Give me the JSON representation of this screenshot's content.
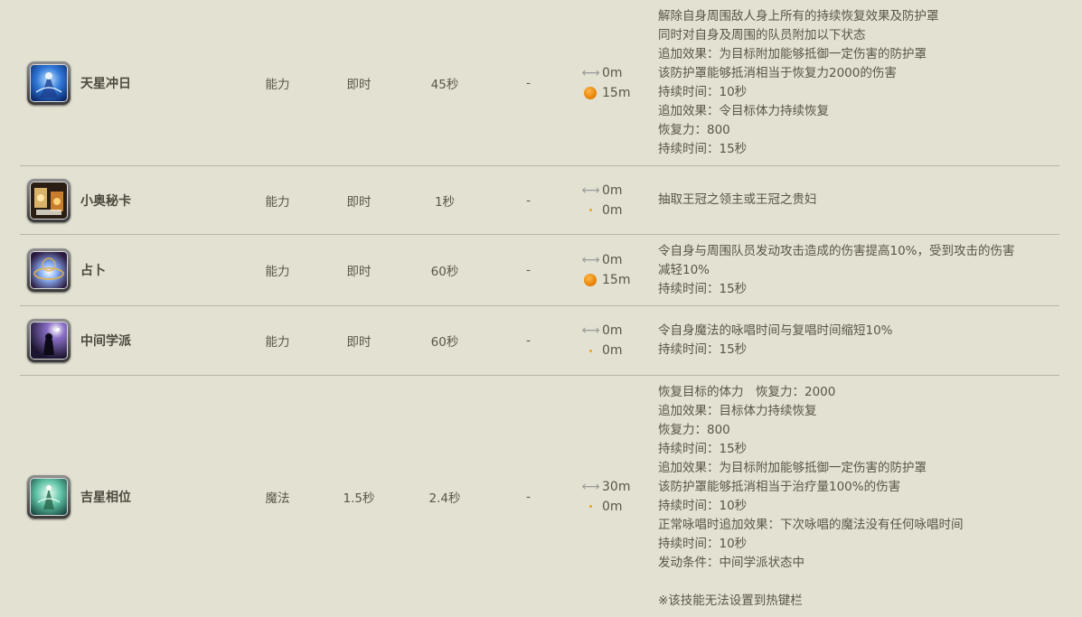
{
  "rows": [
    {
      "name": "天星冲日",
      "type": "能力",
      "cast": "即时",
      "recast": "45秒",
      "cost": "-",
      "range": "0m",
      "radius": "15m",
      "radius_marker": "orb",
      "icon": "astrologian-celestial-opposition-icon",
      "desc": [
        "解除自身周围敌人身上所有的持续恢复效果及防护罩",
        "同时对自身及周围的队员附加以下状态",
        "追加效果：为目标附加能够抵御一定伤害的防护罩",
        "该防护罩能够抵消相当于恢复力2000的伤害",
        "持续时间：10秒",
        "追加效果：令目标体力持续恢复",
        "恢复力：800",
        "持续时间：15秒"
      ]
    },
    {
      "name": "小奥秘卡",
      "type": "能力",
      "cast": "即时",
      "recast": "1秒",
      "cost": "-",
      "range": "0m",
      "radius": "0m",
      "radius_marker": "dot",
      "icon": "minor-arcana-icon",
      "desc": [
        "抽取王冠之领主或王冠之贵妇"
      ]
    },
    {
      "name": "占卜",
      "type": "能力",
      "cast": "即时",
      "recast": "60秒",
      "cost": "-",
      "range": "0m",
      "radius": "15m",
      "radius_marker": "orb",
      "icon": "divination-icon",
      "desc": [
        "令自身与周围队员发动攻击造成的伤害提高10%，受到攻击的伤害",
        "减轻10%",
        "持续时间：15秒"
      ]
    },
    {
      "name": "中间学派",
      "type": "能力",
      "cast": "即时",
      "recast": "60秒",
      "cost": "-",
      "range": "0m",
      "radius": "0m",
      "radius_marker": "dot",
      "icon": "neutral-sect-icon",
      "desc": [
        "令自身魔法的咏唱时间与复唱时间缩短10%",
        "持续时间：15秒"
      ]
    },
    {
      "name": "吉星相位",
      "type": "魔法",
      "cast": "1.5秒",
      "recast": "2.4秒",
      "cost": "-",
      "range": "30m",
      "radius": "0m",
      "radius_marker": "dot",
      "icon": "aspected-benefic-icon",
      "desc": [
        "恢复目标的体力　恢复力：2000",
        "追加效果：目标体力持续恢复",
        "恢复力：800",
        "持续时间：15秒",
        "追加效果：为目标附加能够抵御一定伤害的防护罩",
        "该防护罩能够抵消相当于治疗量100%的伤害",
        "持续时间：10秒",
        "正常咏唱时追加效果：下次咏唱的魔法没有任何咏唱时间",
        "持续时间：10秒",
        "发动条件：中间学派状态中",
        "",
        "※该技能无法设置到热键栏"
      ]
    }
  ],
  "colors": {
    "background": "#e3e1d2",
    "text": "#5a5548",
    "divider": "#b9b6a6",
    "orb": "#e57e00"
  }
}
